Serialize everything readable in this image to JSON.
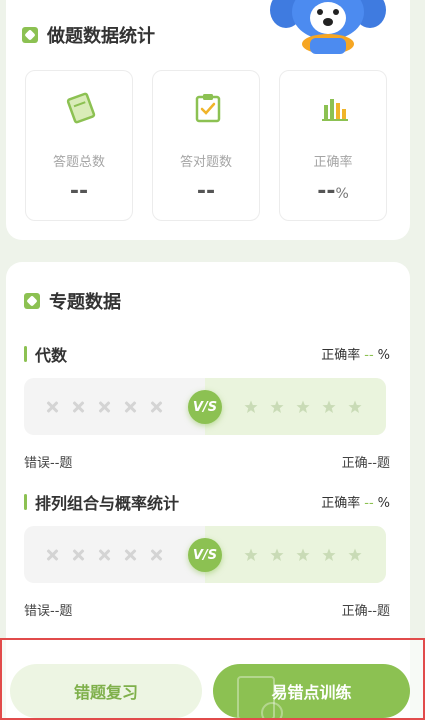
{
  "stats": {
    "title": "做题数据统计",
    "items": [
      {
        "label": "答题总数",
        "value": "--",
        "unit": ""
      },
      {
        "label": "答对题数",
        "value": "--",
        "unit": ""
      },
      {
        "label": "正确率",
        "value": "--",
        "unit": "%"
      }
    ]
  },
  "topics": {
    "title": "专题数据",
    "rate_label": "正确率",
    "rate_unit": "%",
    "vs_label": "V/S",
    "items": [
      {
        "name": "代数",
        "rate": "--",
        "wrong": "错误--题",
        "right": "正确--题"
      },
      {
        "name": "排列组合与概率统计",
        "rate": "--",
        "wrong": "错误--题",
        "right": "正确--题"
      }
    ]
  },
  "actions": {
    "review_label": "错题复习",
    "train_label": "易错点训练"
  },
  "colors": {
    "accent": "#8cc152",
    "accent_light": "#edf5e3",
    "highlight_border": "#e14b4b"
  }
}
